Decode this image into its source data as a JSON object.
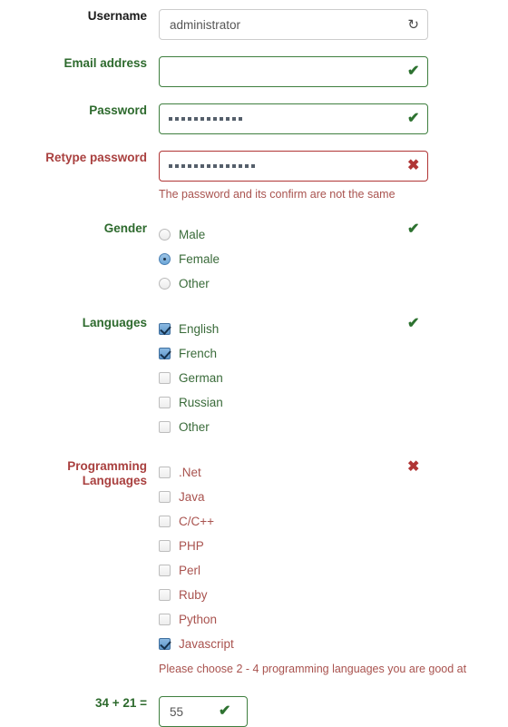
{
  "fields": {
    "username": {
      "label": "Username",
      "value": "administrator",
      "placeholder": "",
      "icon": "refresh-icon",
      "icon_glyph": "↻",
      "state": "neutral"
    },
    "email": {
      "label": "Email address",
      "value": "",
      "placeholder": "",
      "state": "valid",
      "mark": "✔"
    },
    "password": {
      "label": "Password",
      "value": "••••••••••••",
      "dot_count": 12,
      "state": "valid",
      "mark": "✔"
    },
    "retype_password": {
      "label": "Retype password",
      "value": "••••••••••••••",
      "dot_count": 14,
      "state": "invalid",
      "mark": "✖",
      "error": "The password and its confirm are not the same"
    }
  },
  "gender": {
    "label": "Gender",
    "state": "valid",
    "mark": "✔",
    "options": [
      {
        "label": "Male",
        "selected": false
      },
      {
        "label": "Female",
        "selected": true
      },
      {
        "label": "Other",
        "selected": false
      }
    ]
  },
  "languages": {
    "label": "Languages",
    "state": "valid",
    "mark": "✔",
    "options": [
      {
        "label": "English",
        "checked": true
      },
      {
        "label": "French",
        "checked": true
      },
      {
        "label": "German",
        "checked": false
      },
      {
        "label": "Russian",
        "checked": false
      },
      {
        "label": "Other",
        "checked": false
      }
    ]
  },
  "programming_languages": {
    "label_line1": "Programming",
    "label_line2": "Languages",
    "state": "invalid",
    "mark": "✖",
    "error": "Please choose 2 - 4 programming languages you are good at",
    "options": [
      {
        "label": ".Net",
        "checked": false
      },
      {
        "label": "Java",
        "checked": false
      },
      {
        "label": "C/C++",
        "checked": false
      },
      {
        "label": "PHP",
        "checked": false
      },
      {
        "label": "Perl",
        "checked": false
      },
      {
        "label": "Ruby",
        "checked": false
      },
      {
        "label": "Python",
        "checked": false
      },
      {
        "label": "Javascript",
        "checked": true
      }
    ]
  },
  "captcha": {
    "operand_a": "34",
    "operator": "+",
    "operand_b": "21",
    "equals": "=",
    "label": "34 + 21 =",
    "value": "55",
    "placeholder": "",
    "state": "valid",
    "mark": "✔"
  },
  "colors": {
    "valid": "#2d7230",
    "invalid": "#b03535",
    "label_green": "#2d6a2d",
    "label_red": "#a9403f",
    "helper_red": "#a9534f",
    "neutral_border": "#cccccc",
    "checkbox_blue": "#5d96c9"
  }
}
